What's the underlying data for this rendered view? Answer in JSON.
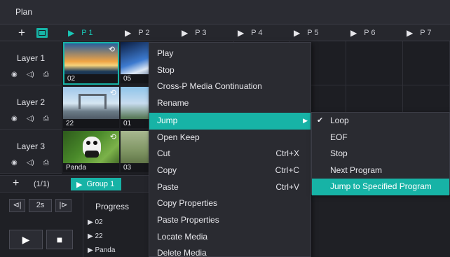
{
  "window": {
    "title": "Plan"
  },
  "header": {
    "add_symbol": "+",
    "programs": [
      "P 1",
      "P 2",
      "P 3",
      "P 4",
      "P 5",
      "P 6",
      "P 7"
    ]
  },
  "layers": [
    {
      "name": "Layer 1",
      "icons": [
        "◉",
        "◁)",
        "⎙"
      ]
    },
    {
      "name": "Layer 2",
      "icons": [
        "◉",
        "◁)",
        "⎙"
      ]
    },
    {
      "name": "Layer 3",
      "icons": [
        "◉",
        "◁)",
        "⎙"
      ]
    }
  ],
  "media": {
    "p1": [
      "02",
      "22",
      "Panda"
    ],
    "p2": [
      "05",
      "01",
      "03"
    ]
  },
  "group_bar": {
    "add": "+",
    "count": "(1/1)",
    "group": "Group 1"
  },
  "playback": {
    "prev": "⊲|",
    "speed": "2s",
    "next": "|⊳",
    "play": "▶",
    "stop": "■"
  },
  "progress": {
    "header": "Progress",
    "items": [
      "02",
      "22",
      "Panda"
    ]
  },
  "context_menu": {
    "items": [
      {
        "label": "Play",
        "shortcut": ""
      },
      {
        "label": "Stop",
        "shortcut": ""
      },
      {
        "label": "Cross-P Media Continuation",
        "shortcut": ""
      },
      {
        "label": "Rename",
        "shortcut": ""
      },
      {
        "label": "Jump",
        "shortcut": ""
      },
      {
        "label": "Open Keep",
        "shortcut": ""
      },
      {
        "label": "Cut",
        "shortcut": "Ctrl+X"
      },
      {
        "label": "Copy",
        "shortcut": "Ctrl+C"
      },
      {
        "label": "Paste",
        "shortcut": "Ctrl+V"
      },
      {
        "label": "Copy Properties",
        "shortcut": ""
      },
      {
        "label": "Paste Properties",
        "shortcut": ""
      },
      {
        "label": "Locate Media",
        "shortcut": ""
      },
      {
        "label": "Delete Media",
        "shortcut": ""
      }
    ],
    "highlighted": "Jump"
  },
  "jump_submenu": {
    "items": [
      "Loop",
      "EOF",
      "Stop",
      "Next Program",
      "Jump to Specified Program"
    ],
    "checked": "Loop",
    "highlighted": "Jump to Specified Program"
  },
  "colors": {
    "accent": "#17b3a6",
    "background": "#1b1c21",
    "menu": "#2a2b31"
  }
}
